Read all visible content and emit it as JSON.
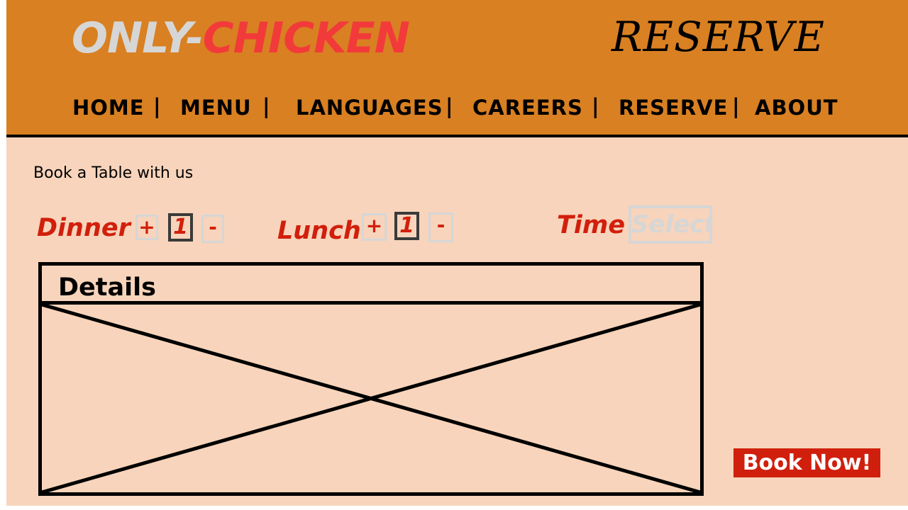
{
  "header": {
    "brand_part1": "ONLY-",
    "brand_part2": "CHICKEN",
    "page_title": "RESERVE",
    "background_color": "#d98022",
    "brand_part1_color": "#d6d6d6",
    "brand_part2_color": "#f23a3a"
  },
  "nav": {
    "items": [
      {
        "label": "HOME"
      },
      {
        "label": "MENU"
      },
      {
        "label": "LANGUAGES"
      },
      {
        "label": "CAREERS"
      },
      {
        "label": "RESERVE"
      },
      {
        "label": "ABOUT"
      }
    ],
    "separator": "|"
  },
  "booking": {
    "intro": "Book a Table with us",
    "dinner": {
      "label": "Dinner",
      "plus": "+",
      "value": "1",
      "minus": "-"
    },
    "lunch": {
      "label": "Lunch",
      "plus": "+",
      "value": "1",
      "minus": "-"
    },
    "time": {
      "label": "Time",
      "placeholder": "Select"
    },
    "accent_color": "#d11f0c"
  },
  "details": {
    "title": "Details",
    "image_placeholder": "image-placeholder-icon"
  },
  "actions": {
    "book_now": "Book Now!",
    "book_now_color": "#d01f0c"
  },
  "page": {
    "background_color": "#f7d4bb"
  }
}
